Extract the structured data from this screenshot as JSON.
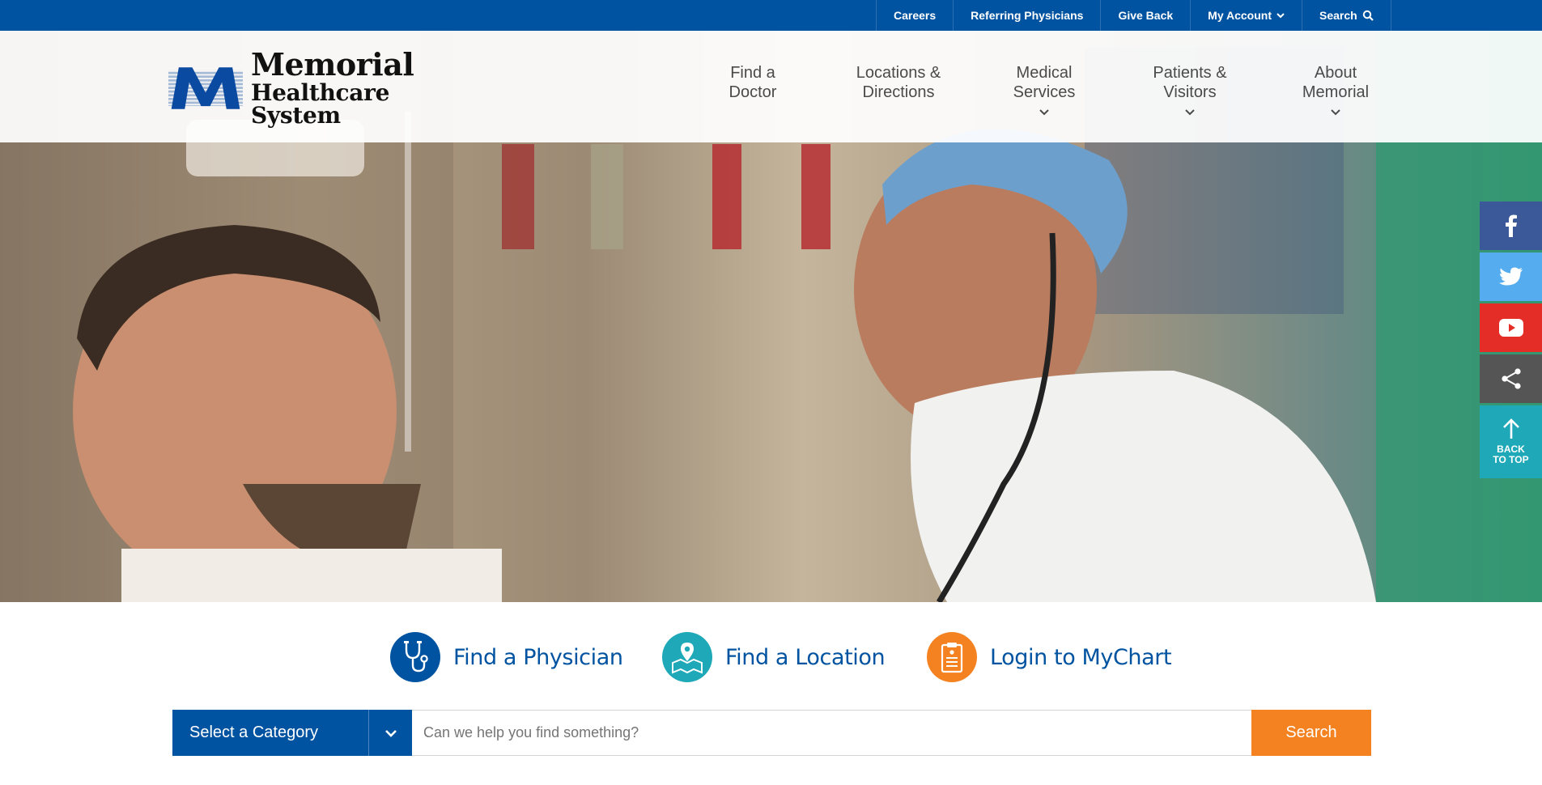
{
  "utility_nav": {
    "items": [
      {
        "label": "Careers"
      },
      {
        "label": "Referring Physicians"
      },
      {
        "label": "Give Back"
      },
      {
        "label": "My Account"
      },
      {
        "label": "Search"
      }
    ]
  },
  "logo": {
    "line1": "Memorial",
    "line2": "Healthcare System",
    "mark_letter": "M"
  },
  "main_nav": {
    "items": [
      {
        "label": "Find a\nDoctor",
        "has_dropdown": false
      },
      {
        "label": "Locations &\nDirections",
        "has_dropdown": false
      },
      {
        "label": "Medical\nServices",
        "has_dropdown": true
      },
      {
        "label": "Patients &\nVisitors",
        "has_dropdown": true
      },
      {
        "label": "About\nMemorial",
        "has_dropdown": true
      }
    ]
  },
  "social": {
    "facebook_color": "#3b5998",
    "twitter_color": "#55acee",
    "youtube_color": "#e52d27",
    "share_color": "#555555",
    "back_top_color": "#1fa9b8",
    "back_top_line1": "BACK",
    "back_top_line2": "TO TOP"
  },
  "quick_links": {
    "physician": {
      "label": "Find a Physician",
      "icon": "stethoscope-icon",
      "color": "#0053a0"
    },
    "location": {
      "label": "Find a Location",
      "icon": "map-pin-icon",
      "color": "#1fa9b8"
    },
    "mychart": {
      "label": "Login to MyChart",
      "icon": "clipboard-icon",
      "color": "#f58220"
    }
  },
  "search": {
    "category_label": "Select a Category",
    "placeholder": "Can we help you find something?",
    "button_label": "Search"
  },
  "colors": {
    "brand_blue": "#0053a0",
    "accent_orange": "#f58220",
    "accent_teal": "#1fa9b8"
  }
}
